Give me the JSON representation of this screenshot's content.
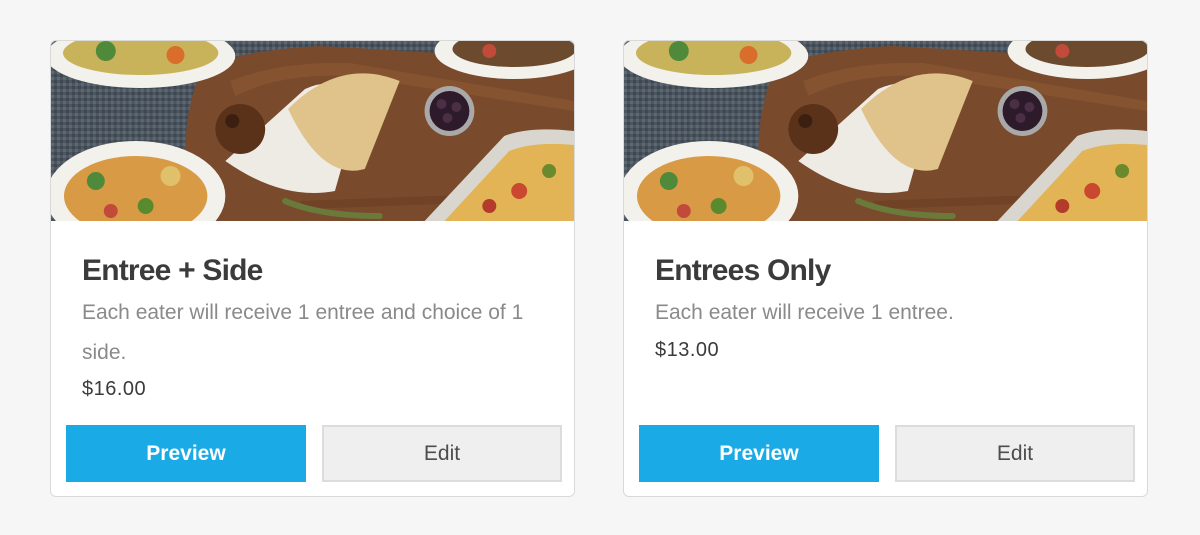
{
  "cards": [
    {
      "title": "Entree + Side",
      "description": "Each eater will receive 1 entree and choice of 1 side.",
      "price": "$16.00",
      "preview_label": "Preview",
      "edit_label": "Edit"
    },
    {
      "title": "Entrees Only",
      "description": "Each eater will receive 1 entree.",
      "price": "$13.00",
      "preview_label": "Preview",
      "edit_label": "Edit"
    }
  ],
  "colors": {
    "page_background": "#f6f6f6",
    "preview_button": "#1aaae5",
    "edit_button": "#efefef",
    "title_text": "#3b3b3b",
    "description_text": "#8a8a8a"
  }
}
